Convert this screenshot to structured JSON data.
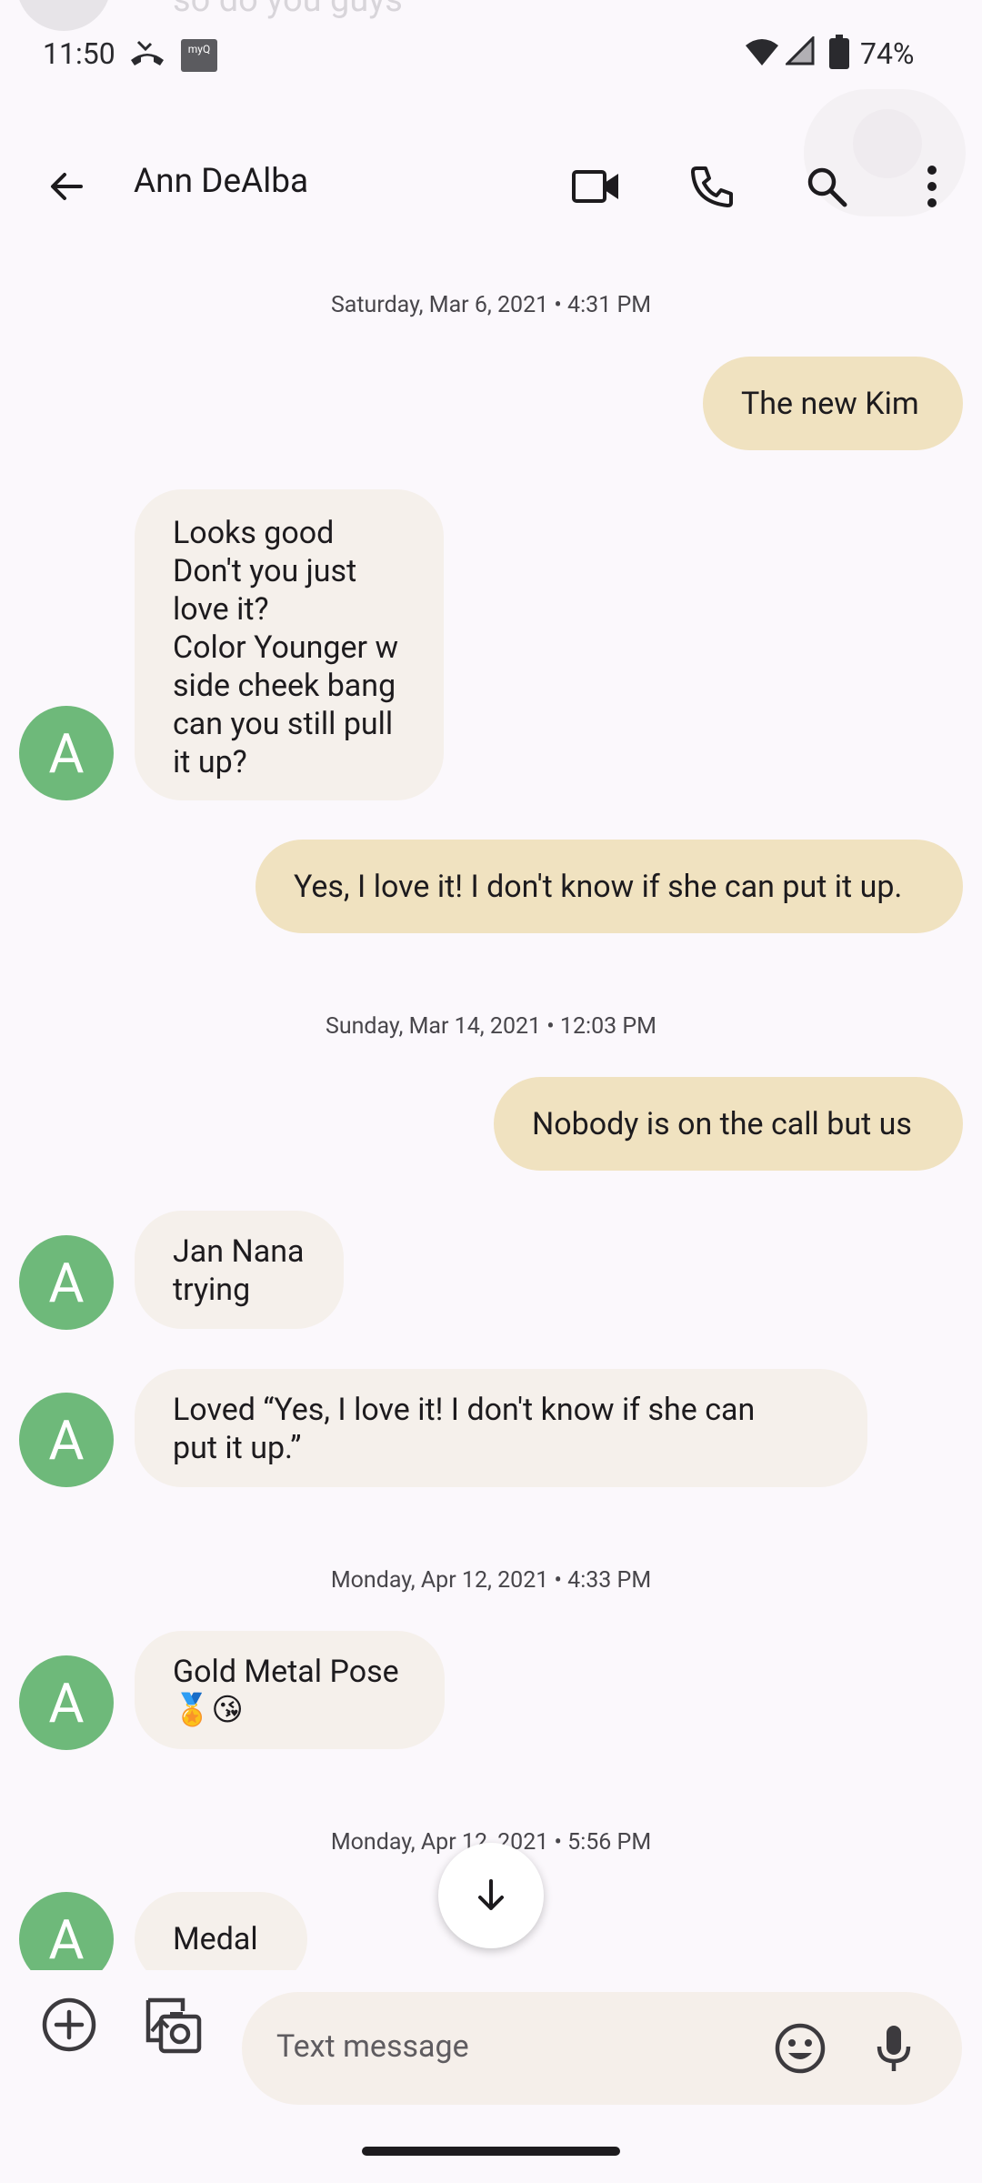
{
  "status_bar": {
    "time": "11:50",
    "myq_label": "myQ",
    "battery_pct": "74%"
  },
  "ghost_preview": {
    "text": "so do you guys"
  },
  "header": {
    "contact_name": "Ann DeAlba"
  },
  "conversation": {
    "dates": [
      "Saturday, Mar 6, 2021 • 4:31 PM",
      "Sunday, Mar 14, 2021 • 12:03 PM",
      "Monday, Apr 12, 2021 • 4:33 PM",
      "Monday, Apr 12, 2021 • 5:56 PM"
    ],
    "avatar_initial": "A",
    "messages": [
      {
        "direction": "outgoing",
        "text": "The new Kim"
      },
      {
        "direction": "incoming",
        "text": "Looks good\nDon't you just\nlove it?\nColor Younger w\nside cheek bang\ncan you still pull\nit up?"
      },
      {
        "direction": "outgoing",
        "text": "Yes, I love it! I don't know if she can put it up."
      },
      {
        "direction": "outgoing",
        "text": "Nobody is on the call but us"
      },
      {
        "direction": "incoming",
        "text": "Jan Nana\ntrying"
      },
      {
        "direction": "incoming",
        "text": "Loved “Yes, I love it! I don't know if she can\nput it up.”"
      },
      {
        "direction": "incoming",
        "text": "Gold Metal Pose\n🏅😘"
      },
      {
        "direction": "incoming",
        "text": "Medal"
      }
    ]
  },
  "compose": {
    "placeholder": "Text message"
  },
  "colors": {
    "outgoing_bubble": "#F0E2C0",
    "incoming_bubble": "#F5F0EB",
    "avatar": "#6EB97A",
    "background": "#FBF8FC"
  }
}
